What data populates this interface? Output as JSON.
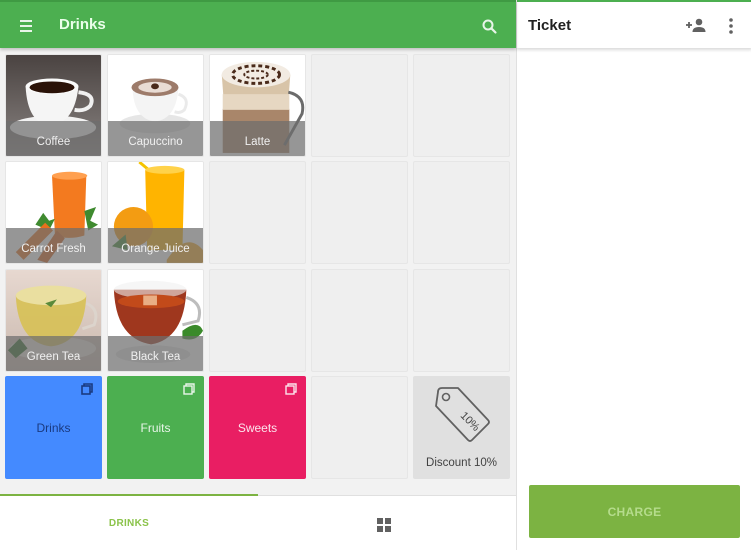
{
  "appbar": {
    "title": "Drinks",
    "menu_icon": "hamburger-menu-icon",
    "search_icon": "search-icon"
  },
  "items": [
    {
      "label": "Coffee",
      "image": "coffee-cup"
    },
    {
      "label": "Capuccino",
      "image": "cappuccino-cup"
    },
    {
      "label": "Latte",
      "image": "latte-glass"
    },
    {
      "label": "Carrot Fresh",
      "image": "carrot-juice"
    },
    {
      "label": "Orange Juice",
      "image": "orange-juice"
    },
    {
      "label": "Green Tea",
      "image": "green-tea-cup"
    },
    {
      "label": "Black Tea",
      "image": "black-tea-cup"
    }
  ],
  "categories": [
    {
      "label": "Drinks",
      "color": "#448aff",
      "text_color": "#1a3a80"
    },
    {
      "label": "Fruits",
      "color": "#4caf50",
      "text_color": "#e8f5e9"
    },
    {
      "label": "Sweets",
      "color": "#e91e63",
      "text_color": "#fce4ec"
    }
  ],
  "discount": {
    "label": "Discount 10%",
    "tag_text": "10%",
    "icon": "price-tag-icon"
  },
  "bottom_tabs": {
    "drinks_label": "DRINKS",
    "grid_icon": "grid-view-icon"
  },
  "ticket": {
    "title": "Ticket",
    "add_customer_icon": "add-person-icon",
    "more_icon": "more-vert-icon",
    "charge_label": "CHARGE"
  },
  "colors": {
    "primary": "#4caf50",
    "accent": "#7cb342",
    "background": "#f2f2f2"
  }
}
